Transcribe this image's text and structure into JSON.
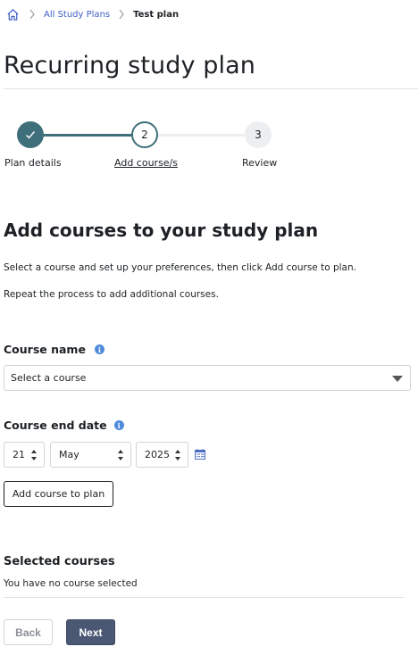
{
  "breadcrumb": {
    "home_icon": "home-icon",
    "items": [
      "All Study Plans",
      "Test plan"
    ]
  },
  "page": {
    "title": "Recurring study plan"
  },
  "stepper": {
    "steps": [
      {
        "number": "",
        "label": "Plan details",
        "state": "complete"
      },
      {
        "number": "2",
        "label": "Add course/s",
        "state": "current"
      },
      {
        "number": "3",
        "label": "Review",
        "state": "upcoming"
      }
    ]
  },
  "section": {
    "title": "Add courses to your study plan",
    "instruction_1": "Select a course and set up your preferences, then click Add course to plan.",
    "instruction_2": "Repeat the process to add additional courses."
  },
  "form": {
    "course_name_label": "Course name",
    "course_select_value": "Select a course",
    "end_date_label": "Course end date",
    "day": "21",
    "month": "May",
    "year": "2025",
    "add_button": "Add course to plan"
  },
  "selected": {
    "title": "Selected courses",
    "empty_text": "You have no course selected"
  },
  "actions": {
    "back": "Back",
    "next": "Next"
  },
  "colors": {
    "accent": "#3f6f7a",
    "link": "#3f5fc4",
    "primary_button": "#4b5873",
    "info": "#4f8bdb"
  }
}
